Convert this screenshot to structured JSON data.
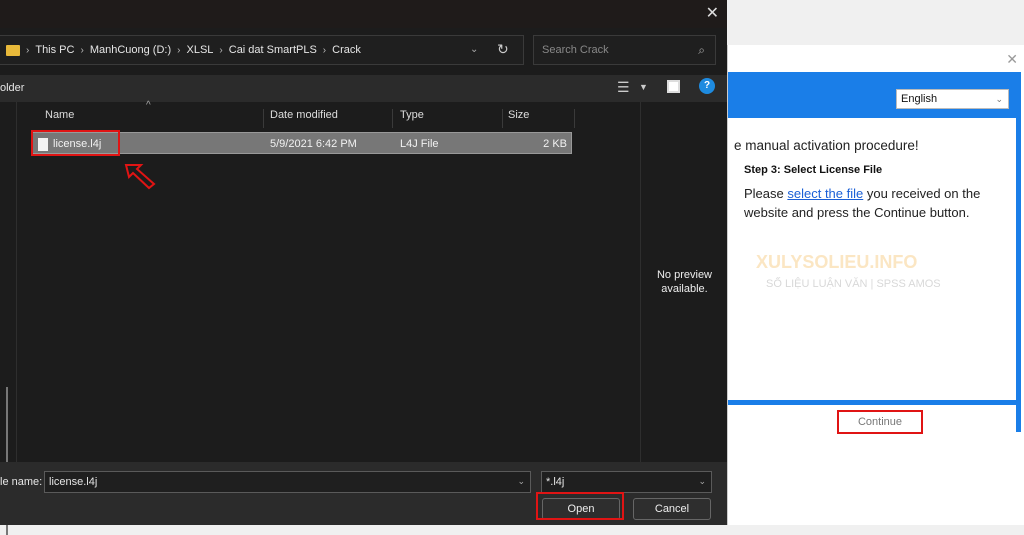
{
  "file_dialog": {
    "address": {
      "crumbs": [
        "This PC",
        "ManhCuong (D:)",
        "XLSL",
        "Cai dat SmartPLS",
        "Crack"
      ]
    },
    "search_placeholder": "Search Crack",
    "toolbar": {
      "new_folder_partial": "older"
    },
    "columns": [
      "Name",
      "Date modified",
      "Type",
      "Size"
    ],
    "files": [
      {
        "name": "license.l4j",
        "date": "5/9/2021 6:42 PM",
        "type": "L4J File",
        "size": "2 KB",
        "selected": true
      }
    ],
    "preview_text": "No preview available.",
    "file_name_label": "le name:",
    "file_name_value": "license.l4j",
    "file_type_value": "*.l4j",
    "open_label": "Open",
    "cancel_label": "Cancel"
  },
  "activation_app": {
    "language": "English",
    "heading_partial": "e manual activation procedure!",
    "step": "Step 3:  Select License File",
    "instruction_pre": "Please ",
    "instruction_link": "select the file",
    "instruction_post": " you received on the website and press the Continue button.",
    "continue_label": "Continue",
    "watermark": {
      "title": "XULYSOLIEU.INFO",
      "subtitle": "SỐ LIỆU LUẬN VĂN | SPSS AMOS"
    }
  },
  "colors": {
    "annotation_red": "#e01414",
    "app_blue": "#1a7ee8",
    "dialog_bg": "#1c1c1c"
  }
}
